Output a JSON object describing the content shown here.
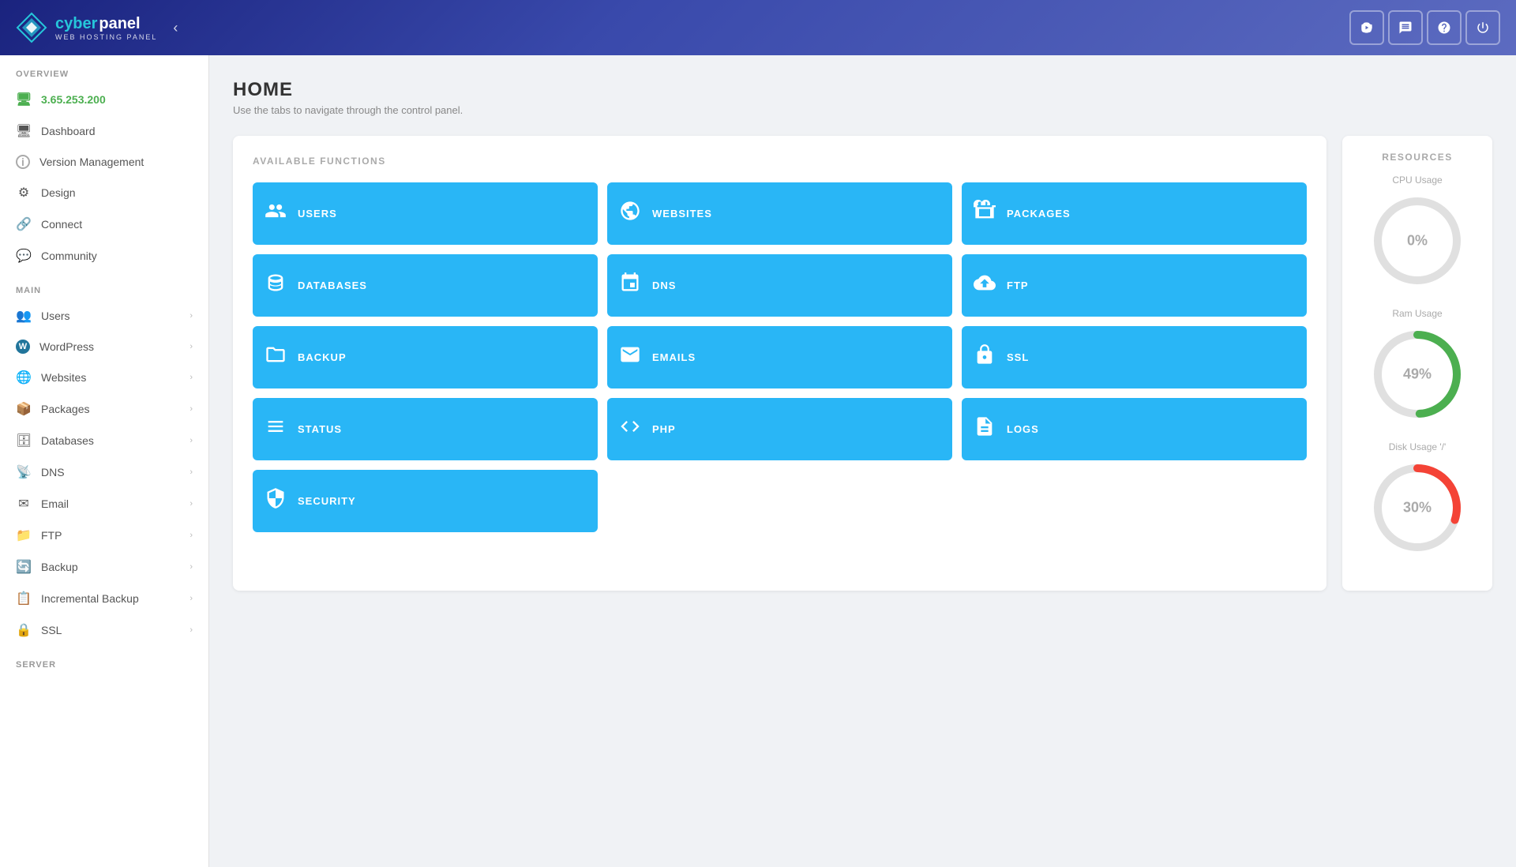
{
  "header": {
    "logo_cyber": "cyber",
    "logo_panel": "panel",
    "logo_sub": "WEB HOSTING PANEL",
    "toggle_icon": "‹",
    "actions": [
      {
        "name": "youtube-icon",
        "symbol": "▶"
      },
      {
        "name": "chat-icon",
        "symbol": "💬"
      },
      {
        "name": "support-icon",
        "symbol": "⊕"
      },
      {
        "name": "power-icon",
        "symbol": "⏻"
      }
    ]
  },
  "sidebar": {
    "overview_label": "OVERVIEW",
    "ip_address": "3.65.253.200",
    "overview_items": [
      {
        "id": "dashboard",
        "label": "Dashboard",
        "icon": "🖥"
      },
      {
        "id": "version-management",
        "label": "Version Management",
        "icon": "ℹ"
      },
      {
        "id": "design",
        "label": "Design",
        "icon": "⚙"
      },
      {
        "id": "connect",
        "label": "Connect",
        "icon": "🔗"
      },
      {
        "id": "community",
        "label": "Community",
        "icon": "💬"
      }
    ],
    "main_label": "MAIN",
    "main_items": [
      {
        "id": "users",
        "label": "Users",
        "icon": "👥",
        "arrow": true
      },
      {
        "id": "wordpress",
        "label": "WordPress",
        "icon": "W",
        "arrow": true
      },
      {
        "id": "websites",
        "label": "Websites",
        "icon": "🌐",
        "arrow": true
      },
      {
        "id": "packages",
        "label": "Packages",
        "icon": "📦",
        "arrow": true
      },
      {
        "id": "databases",
        "label": "Databases",
        "icon": "🗄",
        "arrow": true
      },
      {
        "id": "dns",
        "label": "DNS",
        "icon": "📡",
        "arrow": true
      },
      {
        "id": "email",
        "label": "Email",
        "icon": "✉",
        "arrow": true
      },
      {
        "id": "ftp",
        "label": "FTP",
        "icon": "📁",
        "arrow": true
      },
      {
        "id": "backup",
        "label": "Backup",
        "icon": "🔄",
        "arrow": true
      },
      {
        "id": "incremental-backup",
        "label": "Incremental Backup",
        "icon": "📋",
        "arrow": true
      },
      {
        "id": "ssl",
        "label": "SSL",
        "icon": "🔒",
        "arrow": true
      }
    ],
    "server_label": "SERVER"
  },
  "main": {
    "page_title": "HOME",
    "page_subtitle": "Use the tabs to navigate through the control panel.",
    "functions_title": "AVAILABLE FUNCTIONS",
    "functions": [
      {
        "id": "users",
        "label": "USERS",
        "icon": "👥"
      },
      {
        "id": "websites",
        "label": "WEBSITES",
        "icon": "🌐"
      },
      {
        "id": "packages",
        "label": "PACKAGES",
        "icon": "📦"
      },
      {
        "id": "databases",
        "label": "DATABASES",
        "icon": "🗄"
      },
      {
        "id": "dns",
        "label": "DNS",
        "icon": "📡"
      },
      {
        "id": "ftp",
        "label": "FTP",
        "icon": "☁"
      },
      {
        "id": "backup",
        "label": "BACKUP",
        "icon": "🗂"
      },
      {
        "id": "emails",
        "label": "EMAILS",
        "icon": "✉"
      },
      {
        "id": "ssl",
        "label": "SSL",
        "icon": "🔒"
      },
      {
        "id": "status",
        "label": "STATUS",
        "icon": "📊"
      },
      {
        "id": "php",
        "label": "PHP",
        "icon": "⌨"
      },
      {
        "id": "logs",
        "label": "LOGS",
        "icon": "📄"
      },
      {
        "id": "security",
        "label": "SECURITY",
        "icon": "🛡"
      }
    ]
  },
  "resources": {
    "title": "RESOURCES",
    "items": [
      {
        "label": "CPU Usage",
        "value": 0,
        "color": "#e0e0e0",
        "text": "0%"
      },
      {
        "label": "Ram Usage",
        "value": 49,
        "color": "#4caf50",
        "text": "49%"
      },
      {
        "label": "Disk Usage '/'",
        "value": 30,
        "color": "#f44336",
        "text": "30%"
      }
    ]
  }
}
